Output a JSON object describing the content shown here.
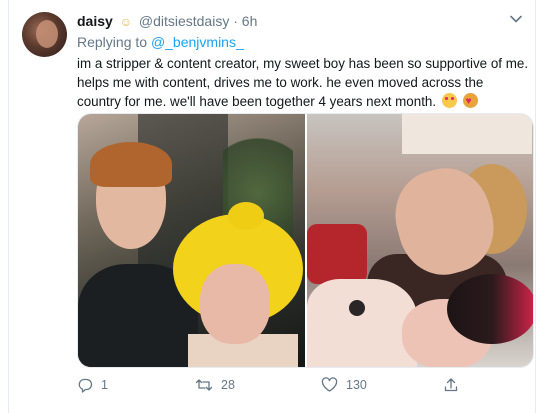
{
  "tweet": {
    "display_name": "daisy",
    "handle": "@ditsiestdaisy",
    "time_separator": "·",
    "time": "6h",
    "replying_to_label": "Replying to",
    "replying_to_handle": "@_benjvmins_",
    "text": "im a stripper & content creator, my sweet boy has been so supportive of me. helps me with content, drives me to work. he even moved across the country for me. we'll have been together 4 years next month.",
    "emojis": [
      "smiling-face-with-hearts-emoji",
      "hearts-emoji"
    ],
    "actions": {
      "reply_count": "1",
      "retweet_count": "28",
      "like_count": "130",
      "share_count": ""
    },
    "icons": [
      "verified-badge-icon",
      "chevron-down-icon",
      "reply-icon",
      "retweet-icon",
      "like-icon",
      "share-icon"
    ],
    "colors": {
      "accent": "#1da1f2",
      "muted": "#657786",
      "text": "#14171a",
      "border": "#e6ecf0"
    }
  }
}
